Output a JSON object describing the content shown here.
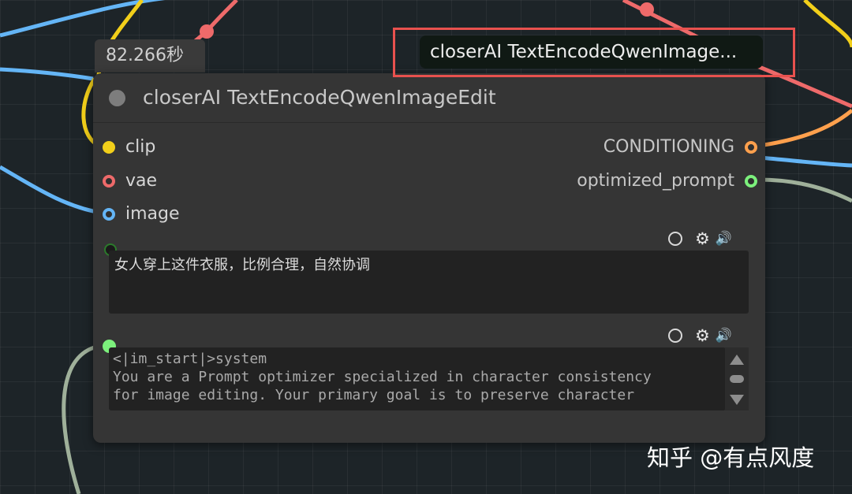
{
  "timer": {
    "label": "82.266秒"
  },
  "badge": {
    "label": "closerAI TextEncodeQwenImage..."
  },
  "node": {
    "title": "closerAI TextEncodeQwenImageEdit",
    "inputs": [
      {
        "label": "clip",
        "color": "#f2cf1a"
      },
      {
        "label": "vae",
        "color": "#ee6a6a"
      },
      {
        "label": "image",
        "color": "#64b5f6"
      }
    ],
    "outputs": [
      {
        "label": "CONDITIONING",
        "color": "#ffa04d"
      },
      {
        "label": "optimized_prompt",
        "color": "#7cf07c"
      }
    ],
    "widgets": [
      {
        "type": "text",
        "value": "女人穿上这件衣服，比例合理，自然协调",
        "tool_icons": [
          "circle-icon",
          "gear-icon",
          "speaker-icon"
        ],
        "link_color": "#1a1a1a"
      },
      {
        "type": "text",
        "lines": [
          "<|im_start|>system",
          "You are a Prompt optimizer specialized in character consistency",
          "for image editing. Your primary goal is to preserve character"
        ],
        "tool_icons": [
          "circle-icon",
          "gear-icon",
          "speaker-icon"
        ],
        "link_color": "#7cf07c"
      }
    ]
  },
  "watermark": {
    "text": "知乎 @有点风度"
  },
  "colors": {
    "canvas": "#1d2428",
    "node_body": "#353535",
    "highlight": "#e8514e",
    "wire_blue": "#64b5f6",
    "wire_yellow": "#f2cf1a",
    "wire_red": "#ee6a6a",
    "wire_orange": "#ffa04d",
    "wire_sage": "#9fb09a"
  }
}
